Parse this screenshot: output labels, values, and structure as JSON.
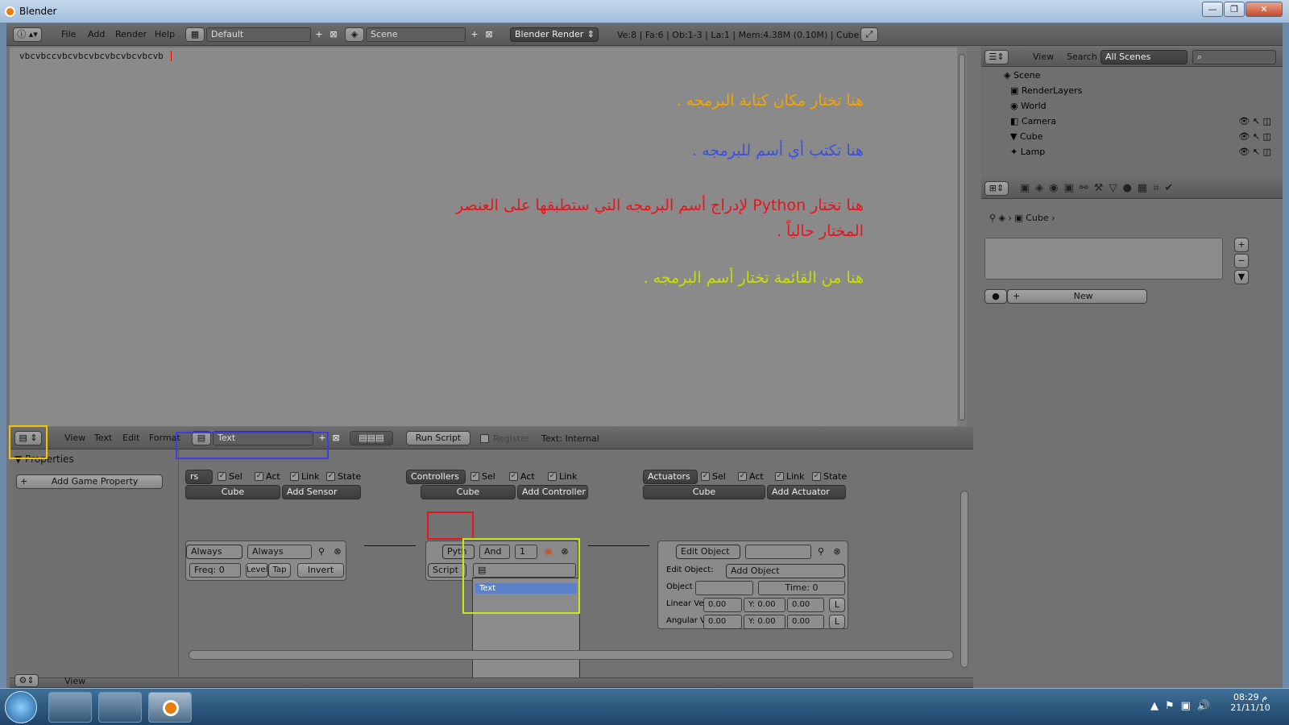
{
  "window": {
    "title": "Blender",
    "minimize": "—",
    "maximize": "❐",
    "close": "✕"
  },
  "topbar": {
    "menus": [
      "File",
      "Add",
      "Render",
      "Help"
    ],
    "layout": "Default",
    "scene": "Scene",
    "engine": "Blender Render",
    "stats": "Ve:8 | Fa:6 | Ob:1-3 | La:1 | Mem:4.38M (0.10M) | Cube"
  },
  "editor": {
    "typed_text": "vbcvbccvbcvbcvbcvbcvbcvbcvb",
    "notes": [
      {
        "text": "هنا تختار مكان كتابة البرمجه .",
        "color": "#f5a400"
      },
      {
        "text": "هنا تكتب أي أسم للبرمجه .",
        "color": "#3b4fe0"
      },
      {
        "text": "هنا تختار Python لإدراج أسم البرمجه التي ستطبقها على العنصر المختار حالياً .",
        "color": "#e8141c"
      },
      {
        "text": "هنا من القائمة تختار أسم البرمجه .",
        "color": "#c8e000"
      }
    ]
  },
  "text_header": {
    "menus": [
      "View",
      "Text",
      "Edit",
      "Format"
    ],
    "text_name": "Text",
    "run_script": "Run Script",
    "register": "Register",
    "status": "Text: Internal"
  },
  "outliner": {
    "menus": [
      "View",
      "Search"
    ],
    "filter": "All Scenes",
    "items": [
      "Scene",
      "RenderLayers",
      "World",
      "Camera",
      "Cube",
      "Lamp"
    ]
  },
  "properties": {
    "breadcrumb": "Cube",
    "new_button": "New"
  },
  "logic": {
    "panel_title": "Properties",
    "add_property": "Add Game Property",
    "sensors": {
      "header": "rs",
      "sel": "Sel",
      "act": "Act",
      "link": "Link",
      "state": "State",
      "object": "Cube",
      "add": "Add Sensor",
      "type": "Always",
      "name": "Always",
      "freq": "Freq: 0",
      "level": "Level",
      "tap": "Tap",
      "invert": "Invert"
    },
    "controllers": {
      "header": "Controllers",
      "sel": "Sel",
      "act": "Act",
      "link": "Link",
      "object": "Cube",
      "add": "Add Controller",
      "type": "Pyth",
      "name": "And",
      "index": "1",
      "script_label": "Script",
      "dropdown_item": "Text"
    },
    "actuators": {
      "header": "Actuators",
      "sel": "Sel",
      "act": "Act",
      "link": "Link",
      "state": "State",
      "object": "Cube",
      "add": "Add Actuator",
      "type": "Edit Object",
      "edit_label": "Edit Object:",
      "edit_value": "Add Object",
      "object_label": "Object",
      "time": "Time: 0",
      "linear_label": "Linear Vel",
      "angular_label": "Angular V",
      "x": "0.00",
      "y": "Y: 0.00",
      "z": "0.00",
      "l": "L"
    }
  },
  "bottom_header": {
    "menu": "View"
  },
  "taskbar": {
    "time": "08:29 م",
    "date": "21/11/10"
  },
  "colors": {
    "yellow": "#f5c400",
    "blue": "#3b3fe0",
    "red": "#e8141c",
    "lime": "#c8e61e"
  }
}
